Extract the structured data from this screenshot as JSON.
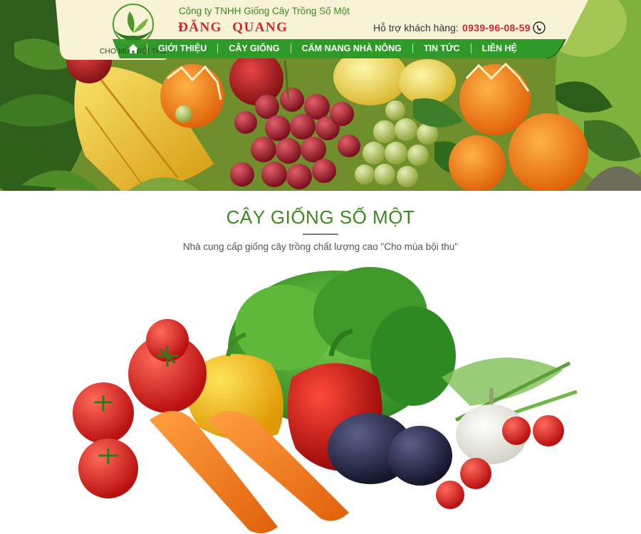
{
  "header": {
    "logo_text": "CHO MÙA BỘI THU",
    "company_line": "Công ty TNHH Giống Cây Trồng Số Một",
    "brand": "ĐĂNG QUANG",
    "support_label": "Hỗ trợ khách hàng:",
    "hotline": "0939-96-08-59"
  },
  "nav": {
    "items": [
      {
        "label": "GIỚI THIỆU"
      },
      {
        "label": "CÂY GIỐNG"
      },
      {
        "label": "CẨM NANG NHÀ NÔNG"
      },
      {
        "label": "TIN TỨC"
      },
      {
        "label": "LIÊN HỆ"
      }
    ]
  },
  "section": {
    "title": "CÂY GIỐNG SỐ MỘT",
    "subtitle": "Nhà cung cấp giống cây trồng chất lượng cao \"Cho mùa bội thu\""
  },
  "colors": {
    "brand_green": "#3a8a1e",
    "nav_green": "#2f9a2a",
    "brand_red": "#d2262a",
    "header_bg": "#f8f3d7"
  },
  "icons": {
    "logo": "leaf-hands-logo",
    "home": "home-icon",
    "phone": "phone-icon"
  }
}
